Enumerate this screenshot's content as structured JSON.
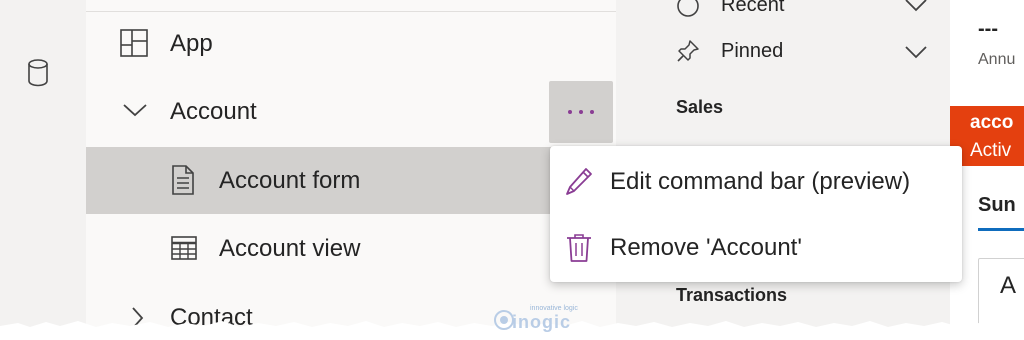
{
  "tree": {
    "items": [
      {
        "label": "App",
        "icon": "grid-icon",
        "level": 0
      },
      {
        "label": "Account",
        "icon": "chevron-down-icon",
        "level": 0,
        "expanded": true
      },
      {
        "label": "Account form",
        "icon": "form-document-icon",
        "level": 1,
        "selected": true
      },
      {
        "label": "Account view",
        "icon": "table-icon",
        "level": 1
      },
      {
        "label": "Contact",
        "icon": "chevron-right-icon",
        "level": 0
      }
    ],
    "more_icon": "ellipsis-icon"
  },
  "rail": {
    "icon": "database-icon"
  },
  "sitemap": {
    "recent_label": "Recent",
    "pinned_label": "Pinned",
    "group_sales": "Sales",
    "group_transactions": "Transactions"
  },
  "context_menu": {
    "items": [
      {
        "label": "Edit command bar (preview)",
        "icon": "pencil-icon"
      },
      {
        "label": "Remove 'Account'",
        "icon": "trash-icon"
      }
    ]
  },
  "preview": {
    "dash": "---",
    "ann_text": "Annu",
    "badge_title": "acco",
    "badge_status": "Activ",
    "tab_label": "Sun",
    "card_letter": "A"
  },
  "watermark": {
    "tagline": "innovative logic",
    "brand": "inogic"
  },
  "colors": {
    "accent_purple": "#8a3d94",
    "selected_row": "#d2d0ce",
    "badge_orange": "#e4400f",
    "tab_underline": "#0f6cbd"
  }
}
